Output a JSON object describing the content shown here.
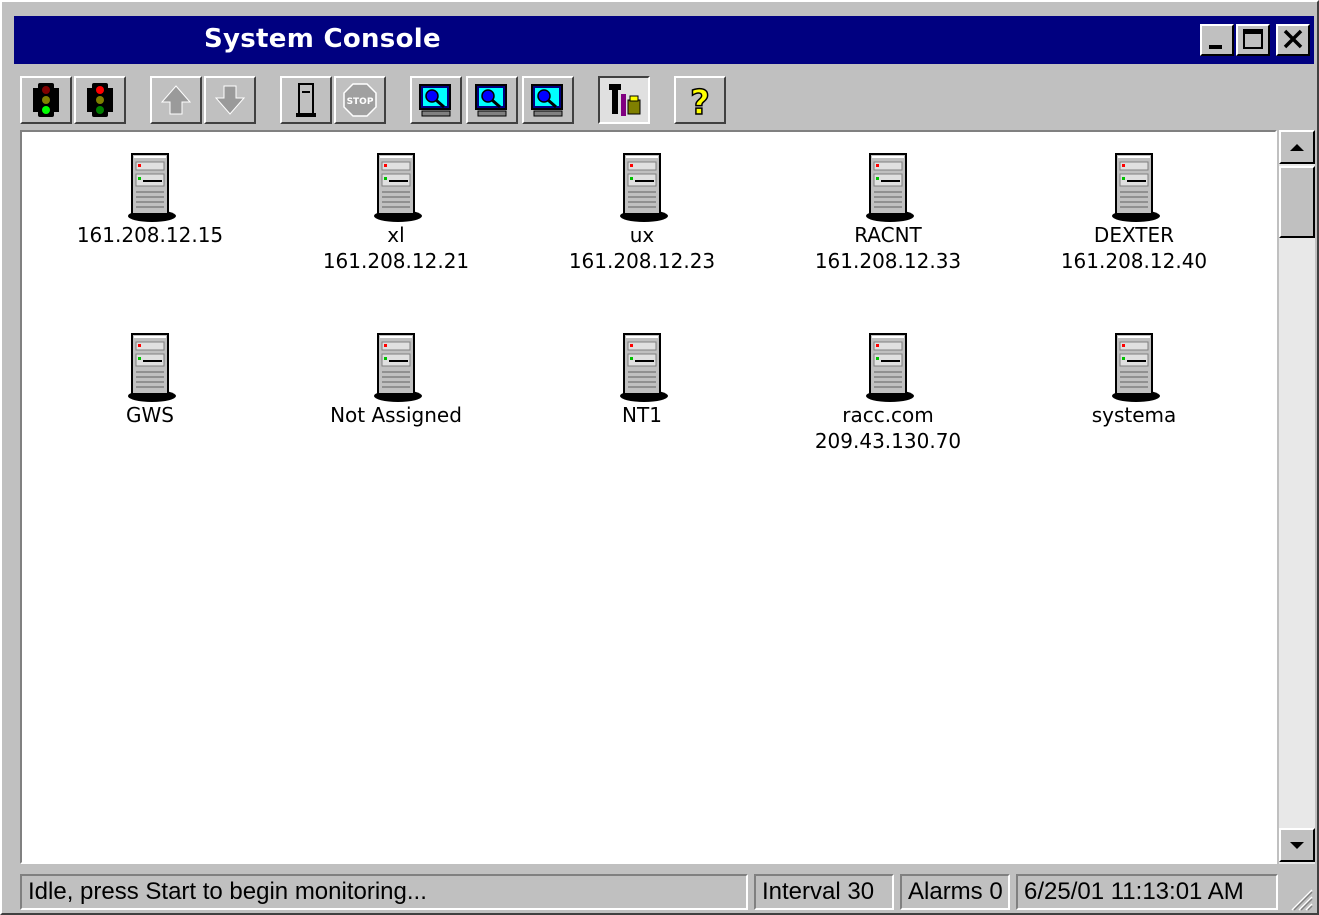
{
  "window": {
    "title": "System Console",
    "controls": [
      "minimize",
      "maximize",
      "close"
    ]
  },
  "toolbar": {
    "buttons": [
      {
        "name": "start-monitoring",
        "icon": "traffic-light-green-icon"
      },
      {
        "name": "stop-monitoring",
        "icon": "traffic-light-red-icon"
      },
      {
        "name": "move-up",
        "icon": "arrow-up-icon",
        "disabled": true
      },
      {
        "name": "move-down",
        "icon": "arrow-down-icon",
        "disabled": true
      },
      {
        "name": "server",
        "icon": "server-icon"
      },
      {
        "name": "stop",
        "icon": "stop-sign-icon",
        "disabled": true
      },
      {
        "name": "monitor-1",
        "icon": "monitor-magnifier-icon"
      },
      {
        "name": "monitor-2",
        "icon": "monitor-magnifier-icon"
      },
      {
        "name": "monitor-3",
        "icon": "monitor-magnifier-icon"
      },
      {
        "name": "tools",
        "icon": "tools-icon",
        "pressed": true
      },
      {
        "name": "help",
        "icon": "question-mark-icon"
      }
    ]
  },
  "nodes": [
    {
      "name": "161.208.12.15",
      "address": ""
    },
    {
      "name": "xl",
      "address": "161.208.12.21"
    },
    {
      "name": "ux",
      "address": "161.208.12.23"
    },
    {
      "name": "RACNT",
      "address": "161.208.12.33"
    },
    {
      "name": "DEXTER",
      "address": "161.208.12.40"
    },
    {
      "name": "GWS",
      "address": ""
    },
    {
      "name": "Not Assigned",
      "address": ""
    },
    {
      "name": "NT1",
      "address": ""
    },
    {
      "name": "racc.com",
      "address": "209.43.130.70"
    },
    {
      "name": "systema",
      "address": ""
    }
  ],
  "statusbar": {
    "message": "Idle, press Start to begin monitoring...",
    "interval": "Interval 30",
    "alarms": "Alarms 0",
    "datetime": "6/25/01 11:13:01 AM"
  },
  "colors": {
    "titlebar": "#000080",
    "face": "#c0c0c0",
    "view_background": "#ffffff"
  }
}
